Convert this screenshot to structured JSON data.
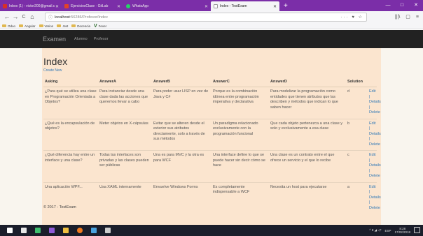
{
  "browser": {
    "tabs": [
      {
        "label": "Inbox (1) - victor200@gmail.c",
        "color": "#d93025",
        "active": false
      },
      {
        "label": "EjerciciosClase · GitLab",
        "color": "#e24329",
        "active": false
      },
      {
        "label": "WhatsApp",
        "color": "#25d366",
        "active": false
      },
      {
        "label": "Index - TestExam",
        "color": "#dddddd",
        "active": true
      }
    ],
    "newtab": "+",
    "window_controls": [
      "—",
      "□",
      "✕"
    ],
    "url_host": "localhost",
    "url_path": ":56286/Profesor/Index",
    "url_right": "··· ♥ ☆",
    "nav_back": "←",
    "nav_forward": "→",
    "nav_reload": "C",
    "nav_home": "⌂",
    "nav_right": [
      "|||\\",
      "▢",
      "≡"
    ],
    "bookmarks": [
      "Odoo",
      "Angular",
      "Varios",
      ".Net",
      "Docencia"
    ],
    "bookmark_fever": "Fever"
  },
  "app": {
    "brand": "Examen",
    "nav": [
      "Alumno",
      "Profesor"
    ]
  },
  "page": {
    "title": "Index",
    "create_link": "Create New",
    "columns": [
      "Asking",
      "AnswerA",
      "AnswerB",
      "AnswerC",
      "AnswerD",
      "Solution",
      ""
    ],
    "rows": [
      {
        "asking": "¿Para qué se utiliza una clase en Programación Orientada a Objetos?",
        "a": "Para instanciar desde una clase dada las acciones que queremos llevar a cabo",
        "b": "Para poder usar LISP en vez de Java y C#",
        "c": "Porque es la combinación idónea entre programación imperativa y declarativa",
        "d": "Para modelizar la programación como entidades que tienen atributos que las describen y métodos que indican lo que saben hacer",
        "solution": "d"
      },
      {
        "asking": "¿Qué es la encapsulación de objetos?",
        "a": "Meter objetos en X-cápsulas",
        "b": "Evitar que se alteren desde el exterior sus atributos directamente, solo a través de sus métodos",
        "c": "Un paradigma relacionado exclusivamente con la programación funcional",
        "d": "Que cada objeto pertenezca a una clase y solo y exclusivamente a esa clase",
        "solution": "b"
      },
      {
        "asking": "¿Qué diferencia hay entre un interface y una clase?",
        "a": "Todas las interfaces son privadas y las clases pueden ser públicas",
        "b": "Una es para MVC y la otra es para WCF",
        "c": "Una interface define lo que se puede hacer sin decir cómo se hace",
        "d": "Una clase es un contrato entre el que ofrece un servicio y el que lo recibe",
        "solution": "c"
      },
      {
        "asking": "Una aplicación WPF...",
        "a": "Usa XAML internamente",
        "b": "Envuelve Windows Forms",
        "c": "Es completamente indispensable a WCF",
        "d": "Necesita un host para ejecutarse",
        "solution": "a"
      }
    ],
    "actions": [
      "Edit |",
      "Details |",
      "Delete"
    ],
    "footer": "© 2017 - TestExam"
  },
  "taskbar": {
    "icons": [
      {
        "name": "windows-start-icon",
        "color": "#ffffff"
      },
      {
        "name": "task-view-icon",
        "color": "#e8e8e8"
      },
      {
        "name": "app-green-icon",
        "color": "#3fbf6f"
      },
      {
        "name": "visual-studio-icon",
        "color": "#8e5ad8"
      },
      {
        "name": "file-explorer-icon",
        "color": "#f0c040"
      },
      {
        "name": "firefox-icon",
        "color": "#f07a20"
      },
      {
        "name": "app-blue-icon",
        "color": "#4aa3df"
      },
      {
        "name": "app-grey-icon",
        "color": "#cccccc"
      }
    ],
    "tray_left": "^ ♥ ◢ ◁ᶻ",
    "lang": "ESP",
    "time": "8:28",
    "date": "17/02/2018"
  }
}
